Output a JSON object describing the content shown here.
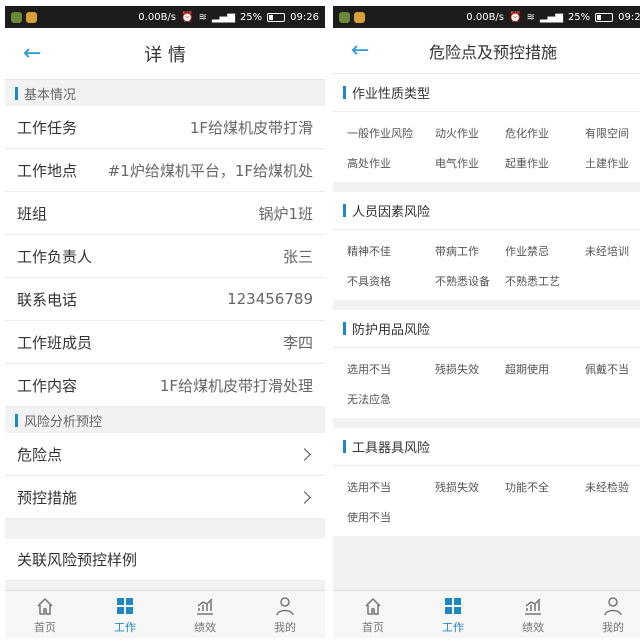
{
  "status": {
    "speed": "0.00B/s",
    "battery": "25%",
    "time": "09:26"
  },
  "left": {
    "title": "详 情",
    "section1": "基本情况",
    "rows": [
      {
        "label": "工作任务",
        "value": "1F给煤机皮带打滑"
      },
      {
        "label": "工作地点",
        "value": "#1炉给煤机平台，1F给煤机处"
      },
      {
        "label": "班组",
        "value": "锅炉1班"
      },
      {
        "label": "工作负责人",
        "value": "张三"
      },
      {
        "label": "联系电话",
        "value": "123456789"
      },
      {
        "label": "工作班成员",
        "value": "李四"
      },
      {
        "label": "工作内容",
        "value": "1F给煤机皮带打滑处理"
      }
    ],
    "section2": "风险分析预控",
    "links": [
      "危险点",
      "预控措施"
    ],
    "related": "关联风险预控样例"
  },
  "right": {
    "title": "危险点及预控措施",
    "sections": [
      {
        "name": "作业性质类型",
        "items": [
          "一般作业风险",
          "动火作业",
          "危化作业",
          "有限空间",
          "高处作业",
          "电气作业",
          "起重作业",
          "土建作业"
        ]
      },
      {
        "name": "人员因素风险",
        "items": [
          "精神不佳",
          "带病工作",
          "作业禁忌",
          "未经培训",
          "不具资格",
          "不熟悉设备",
          "不熟悉工艺"
        ]
      },
      {
        "name": "防护用品风险",
        "items": [
          "选用不当",
          "残损失效",
          "超期使用",
          "佩戴不当",
          "无法应急"
        ]
      },
      {
        "name": "工具器具风险",
        "items": [
          "选用不当",
          "残损失效",
          "功能不全",
          "未经检验",
          "使用不当"
        ]
      }
    ]
  },
  "tabs": [
    {
      "label": "首页",
      "icon": "home-icon"
    },
    {
      "label": "工作",
      "icon": "grid-icon",
      "active": true
    },
    {
      "label": "绩效",
      "icon": "chart-icon"
    },
    {
      "label": "我的",
      "icon": "user-icon"
    }
  ],
  "colors": {
    "accent": "#1e88c7",
    "back_arrow": "#2a9bd6"
  }
}
